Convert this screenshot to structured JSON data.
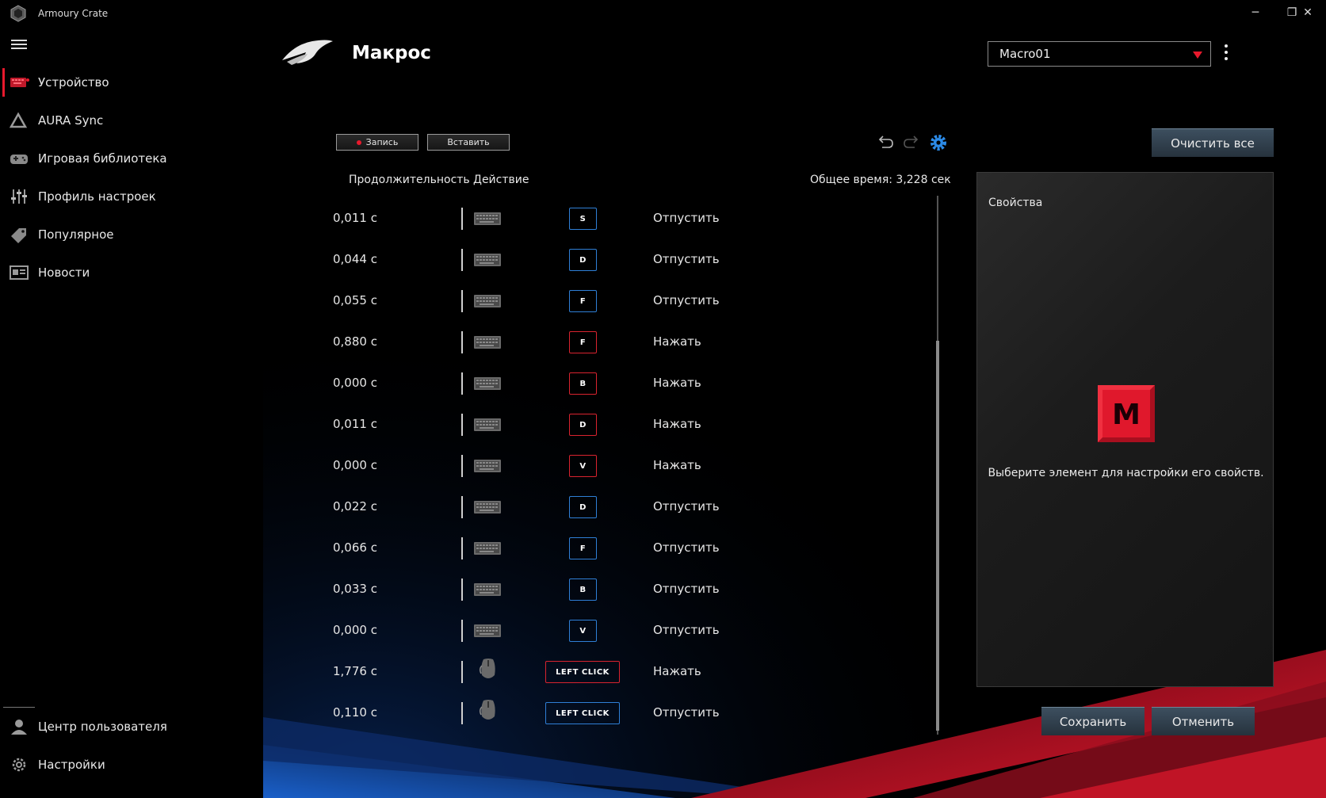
{
  "app": {
    "title": "Armoury Crate"
  },
  "window": {
    "minimize": "─",
    "restore": "❐",
    "close": "✕"
  },
  "sidebar": {
    "items": [
      {
        "label": "Устройство",
        "icon": "keyboard-icon",
        "active": true
      },
      {
        "label": "AURA Sync",
        "icon": "aura-icon"
      },
      {
        "label": "Игровая библиотека",
        "icon": "gamepad-icon"
      },
      {
        "label": "Профиль настроек",
        "icon": "sliders-icon"
      },
      {
        "label": "Популярное",
        "icon": "tag-icon"
      },
      {
        "label": "Новости",
        "icon": "news-icon"
      }
    ],
    "bottom": [
      {
        "label": "Центр пользователя",
        "icon": "user-icon"
      },
      {
        "label": "Настройки",
        "icon": "gear-icon"
      }
    ]
  },
  "header": {
    "title": "Макрос",
    "profile": "Macro01"
  },
  "toolbar": {
    "record": "Запись",
    "insert": "Вставить",
    "clear_all": "Очистить все"
  },
  "table": {
    "col_duration": "Продолжительность",
    "col_action": "Действие",
    "total_time": "Общее время: 3,228 сек",
    "rows": [
      {
        "duration": "0,011 с",
        "device": "keyboard",
        "key": "S",
        "action": "Отпустить",
        "state": "release"
      },
      {
        "duration": "0,044 с",
        "device": "keyboard",
        "key": "D",
        "action": "Отпустить",
        "state": "release"
      },
      {
        "duration": "0,055 с",
        "device": "keyboard",
        "key": "F",
        "action": "Отпустить",
        "state": "release"
      },
      {
        "duration": "0,880 с",
        "device": "keyboard",
        "key": "F",
        "action": "Нажать",
        "state": "press"
      },
      {
        "duration": "0,000 с",
        "device": "keyboard",
        "key": "B",
        "action": "Нажать",
        "state": "press"
      },
      {
        "duration": "0,011 с",
        "device": "keyboard",
        "key": "D",
        "action": "Нажать",
        "state": "press"
      },
      {
        "duration": "0,000 с",
        "device": "keyboard",
        "key": "V",
        "action": "Нажать",
        "state": "press"
      },
      {
        "duration": "0,022 с",
        "device": "keyboard",
        "key": "D",
        "action": "Отпустить",
        "state": "release"
      },
      {
        "duration": "0,066 с",
        "device": "keyboard",
        "key": "F",
        "action": "Отпустить",
        "state": "release"
      },
      {
        "duration": "0,033 с",
        "device": "keyboard",
        "key": "B",
        "action": "Отпустить",
        "state": "release"
      },
      {
        "duration": "0,000 с",
        "device": "keyboard",
        "key": "V",
        "action": "Отпустить",
        "state": "release"
      },
      {
        "duration": "1,776 с",
        "device": "mouse",
        "key": "LEFT CLICK",
        "action": "Нажать",
        "state": "press"
      },
      {
        "duration": "0,110 с",
        "device": "mouse",
        "key": "LEFT CLICK",
        "action": "Отпустить",
        "state": "release"
      }
    ]
  },
  "properties": {
    "title": "Свойства",
    "badge": "M",
    "hint": "Выберите элемент для настройки его свойств."
  },
  "footer": {
    "save": "Сохранить",
    "cancel": "Отменить"
  },
  "colors": {
    "accent_red": "#e8192c",
    "release_blue": "#2f7fd6",
    "press_red": "#d9232f",
    "settings_blue": "#2c8be8"
  }
}
